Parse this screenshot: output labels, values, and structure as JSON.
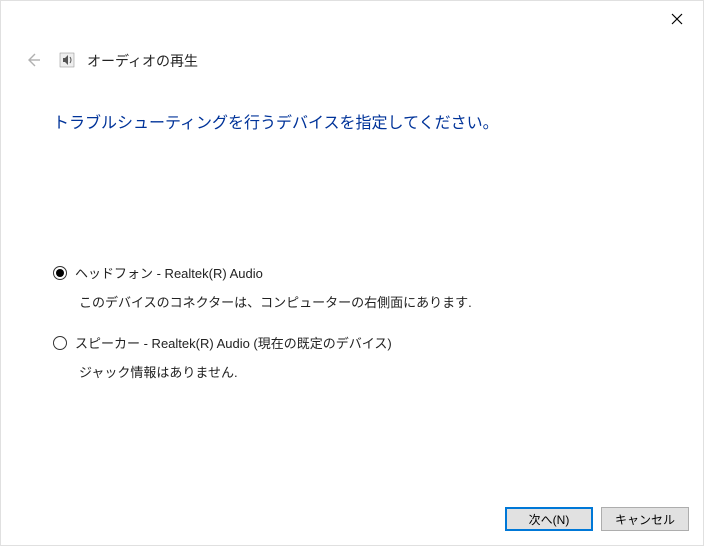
{
  "header": {
    "title": "オーディオの再生"
  },
  "main": {
    "instruction": "トラブルシューティングを行うデバイスを指定してください。"
  },
  "options": [
    {
      "label": "ヘッドフォン - Realtek(R) Audio",
      "description": "このデバイスのコネクターは、コンピューターの右側面にあります.",
      "selected": true
    },
    {
      "label": "スピーカー - Realtek(R) Audio (現在の既定のデバイス)",
      "description": "ジャック情報はありません.",
      "selected": false
    }
  ],
  "footer": {
    "next_label": "次へ(N)",
    "cancel_label": "キャンセル"
  }
}
